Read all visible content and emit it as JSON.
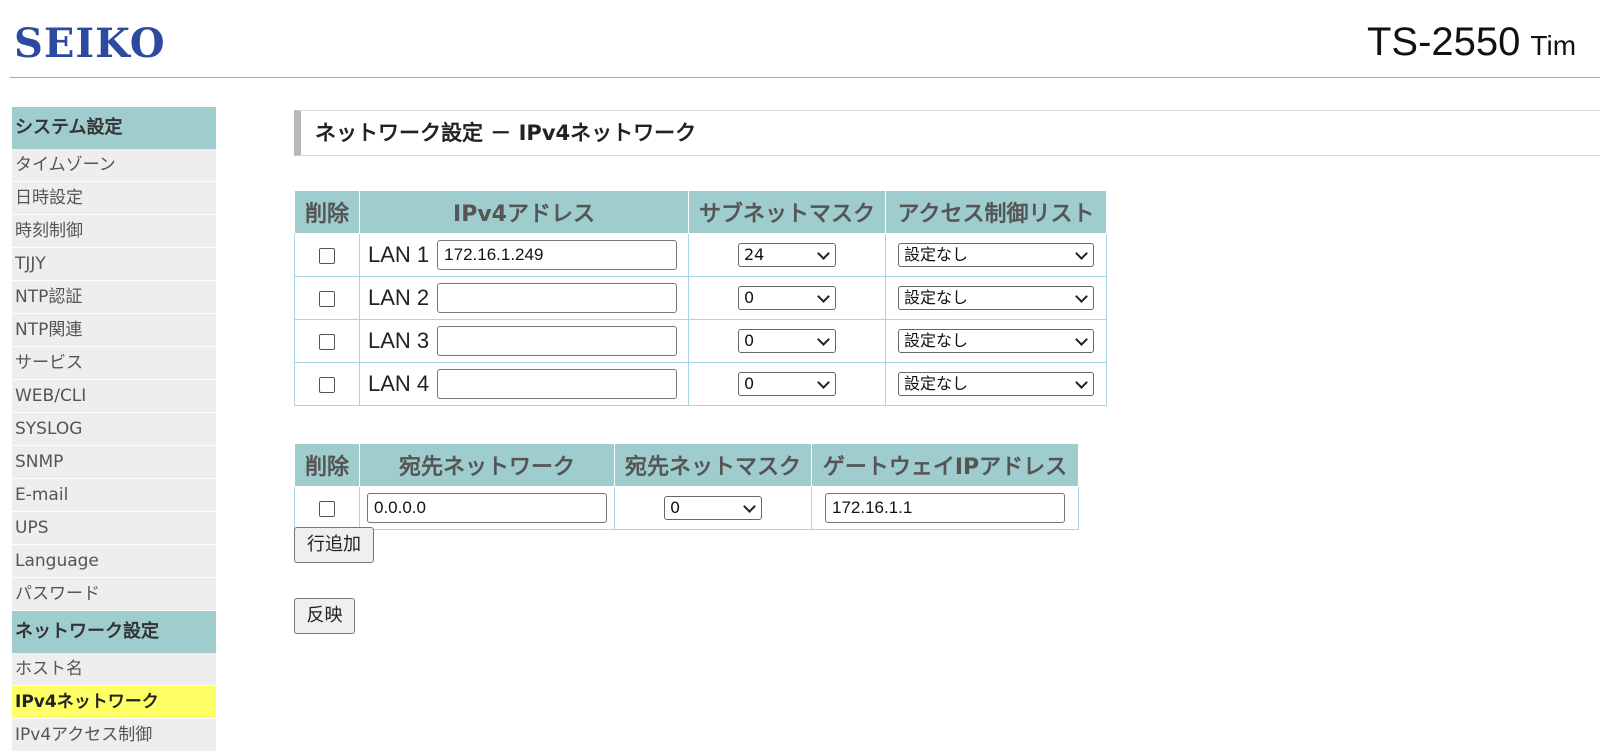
{
  "header": {
    "logo": "SEIKO",
    "model": "TS-2550",
    "model_suffix": "Tim"
  },
  "sidebar": {
    "sections": [
      {
        "title": "システム設定",
        "items": [
          "タイムゾーン",
          "日時設定",
          "時刻制御",
          "TJJY",
          "NTP認証",
          "NTP関連",
          "サービス",
          "WEB/CLI",
          "SYSLOG",
          "SNMP",
          "E-mail",
          "UPS",
          "Language",
          "パスワード"
        ]
      },
      {
        "title": "ネットワーク設定",
        "items": [
          "ホスト名",
          "IPv4ネットワーク",
          "IPv4アクセス制御"
        ]
      }
    ],
    "active_item": "IPv4ネットワーク"
  },
  "page_title": "ネットワーク設定 － IPv4ネットワーク",
  "ipv4_table": {
    "headers": [
      "削除",
      "IPv4アドレス",
      "サブネットマスク",
      "アクセス制御リスト"
    ],
    "rows": [
      {
        "lan": "LAN 1",
        "address": "172.16.1.249",
        "mask": "24",
        "acl": "設定なし"
      },
      {
        "lan": "LAN 2",
        "address": "",
        "mask": "0",
        "acl": "設定なし"
      },
      {
        "lan": "LAN 3",
        "address": "",
        "mask": "0",
        "acl": "設定なし"
      },
      {
        "lan": "LAN 4",
        "address": "",
        "mask": "0",
        "acl": "設定なし"
      }
    ]
  },
  "route_table": {
    "headers": [
      "削除",
      "宛先ネットワーク",
      "宛先ネットマスク",
      "ゲートウェイIPアドレス"
    ],
    "rows": [
      {
        "network": "0.0.0.0",
        "mask": "0",
        "gateway": "172.16.1.1"
      }
    ]
  },
  "buttons": {
    "add_row": "行追加",
    "apply": "反映"
  }
}
